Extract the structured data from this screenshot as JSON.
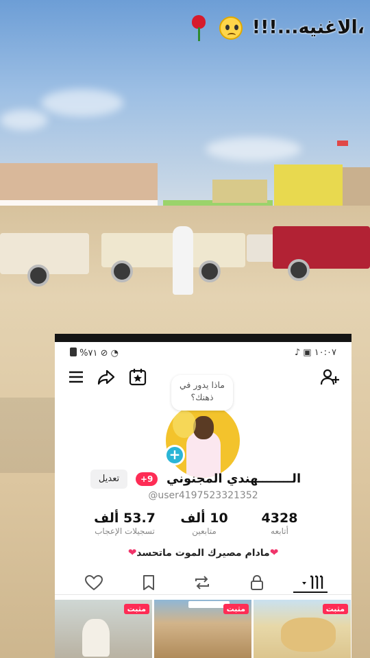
{
  "overlay_caption": {
    "text": "،الاغنيه...!!!",
    "emojis": [
      "crying-face",
      "rose"
    ]
  },
  "status_bar": {
    "time": "١٠:٠٧",
    "battery": "%٧١"
  },
  "profile": {
    "thought_bubble": "ماذا يدور في ذهنك؟",
    "display_name": "الــــــــهندي المجنوني",
    "notification_badge": "+9",
    "edit_label": "تعديل",
    "username": "@user4197523321352",
    "stats": [
      {
        "value": "4328",
        "label": "أتابعه"
      },
      {
        "value": "10 ألف",
        "label": "متابعين"
      },
      {
        "value": "53.7 ألف",
        "label": "تسجيلات الإعجاب"
      }
    ],
    "bio": "مادام مصيرك الموت ماتحسد",
    "bio_emoji": "heart-icon"
  },
  "grid": {
    "pin_label": "مثبت",
    "items": [
      {
        "pinned": true
      },
      {
        "pinned": true
      },
      {
        "pinned": true
      }
    ]
  },
  "colors": {
    "accent": "#fe2c55",
    "avatar_bg": "#f3c32c",
    "plus_badge": "#2ab5d6"
  }
}
